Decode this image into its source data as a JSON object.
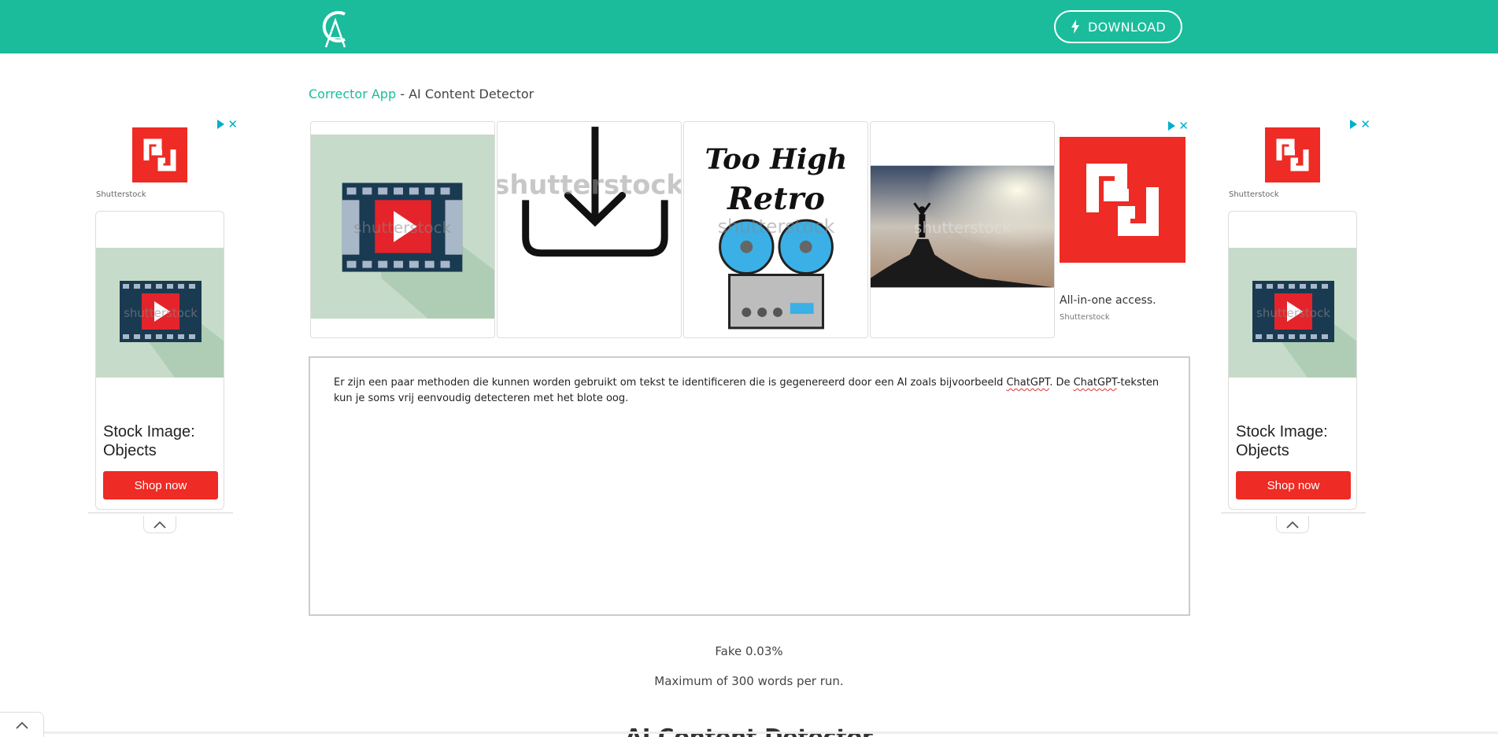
{
  "header": {
    "download_label": "DOWNLOAD"
  },
  "breadcrumb": {
    "home": "Corrector App",
    "separator": " - ",
    "current": "AI Content Detector"
  },
  "ads": {
    "left": {
      "brand": "Shutterstock",
      "headline": "Stock Image: Objects",
      "cta": "Shop now"
    },
    "right": {
      "brand": "Shutterstock",
      "headline": "Stock Image: Objects",
      "cta": "Shop now"
    },
    "banner": {
      "tagline": "All-in-one access.",
      "brand": "Shutterstock",
      "watermark": "shutterstock"
    }
  },
  "editor": {
    "text_before_1": "Er zijn een paar methoden die kunnen worden gebruikt om tekst te identificeren die is gegenereerd door een AI zoals bijvoorbeeld ",
    "misspelled_1": "ChatGPT",
    "text_between": ". De ",
    "misspelled_2": "ChatGPT",
    "text_after": "-teksten kun je soms vrij eenvoudig detecteren met het blote oog."
  },
  "result": {
    "fake_label": "Fake 0.03%",
    "limit_note": "Maximum of 300 words per run."
  },
  "section": {
    "title": "AI Content Detector"
  },
  "colors": {
    "brand": "#1abc9c",
    "ad_red": "#ee2b24",
    "adchoices": "#00aecd"
  }
}
